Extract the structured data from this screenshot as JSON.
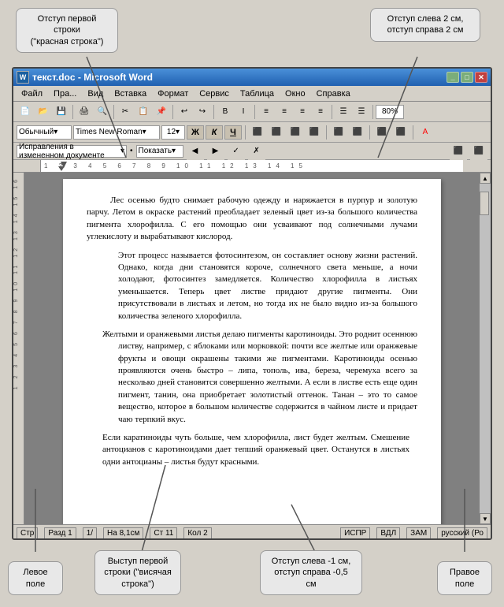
{
  "bubbles": {
    "top_left": "Отступ первой строки\n(\"красная строка\")",
    "top_right": "Отступ слева 2 см,\nотступ справа 2 см",
    "bottom_left": "Левое\nполе",
    "bottom_mid_left": "Выступ первой\nстроки (\"висячая\nстрока\")",
    "bottom_mid_right": "Отступ слева -1 см,\nотступ справа -0,5 см",
    "bottom_right": "Правое\nполе"
  },
  "window": {
    "title": "текст.doc - Microsoft Word",
    "file_icon": "W"
  },
  "menu": {
    "items": [
      "Файл",
      "Пра...",
      "Вид",
      "Вставка",
      "Формат",
      "Сервис",
      "Таблица",
      "Окно",
      "Справка"
    ]
  },
  "format_bar": {
    "style": "Обычный",
    "font": "Times New Roman",
    "size": "12",
    "bold": "Ж",
    "italic": "К",
    "underline": "Ч"
  },
  "track_bar": {
    "label": "Исправления в измененном документе",
    "show": "Показать▾"
  },
  "status_bar": {
    "str": "Стр",
    "razdel": "Разд 1",
    "page": "1/",
    "na": "На 8,1см",
    "str2": "Ст 11",
    "kol": "Кол 2",
    "isp": "ИСПР",
    "vdl": "ВДЛ",
    "zam": "ЗАМ",
    "lang": "русский (Ро"
  },
  "paragraphs": [
    {
      "type": "normal",
      "text": "Лес осенью будто снимает рабочую одежду и наряжается в пурпур и золотую парчу. Летом в окраске растений преобладает зеленый цвет из-за большого количества пигмента хлорофилла. С его помощью они усваивают под солнечными лучами углекислоту и вырабатывают кислород."
    },
    {
      "type": "indent",
      "text": "Этот процесс называется фотосинтезом, он составляет основу жизни растений. Однако, когда дни становятся короче, солнечного света меньше, а ночи холодают, фотосинтез замедляется. Количество хлорофилла в листьях уменьшается. Теперь цвет листве придают другие пигменты. Они присутствовали в листьях и летом, но тогда их не было видно из-за большого количества зеленого хлорофилла."
    },
    {
      "type": "hanging",
      "text": "Желтыми и оранжевыми листья делаю пигменты каротиноиды. Это роднит осеннюю листву, например, с яблоками или морковкой: почти все желтые или оранжевые фрукты и овощи окрашены такими же пигментами. Каротиноиды осенью проявляются очень быстро – липа, тополь, ива, береза, черемуха всего за несколько дней становятся совершенно желтыми. А если в листве есть еще один пигмент, танин, она приобретает золотистый оттенок. Танан – это то самое вещество, которое в большом количестве содержится в чайном листе и придает чаю терпкий вкус."
    },
    {
      "type": "left-right",
      "text": "Если каратиноиды чуть больше, чем хлорофилла, лист будет желтым. Смешение антоцианов с каротиноидами дает тепший оранжевый цвет. Останутся в листьях одни антоцианы – листья будут красными."
    }
  ],
  "zoom": "80%"
}
